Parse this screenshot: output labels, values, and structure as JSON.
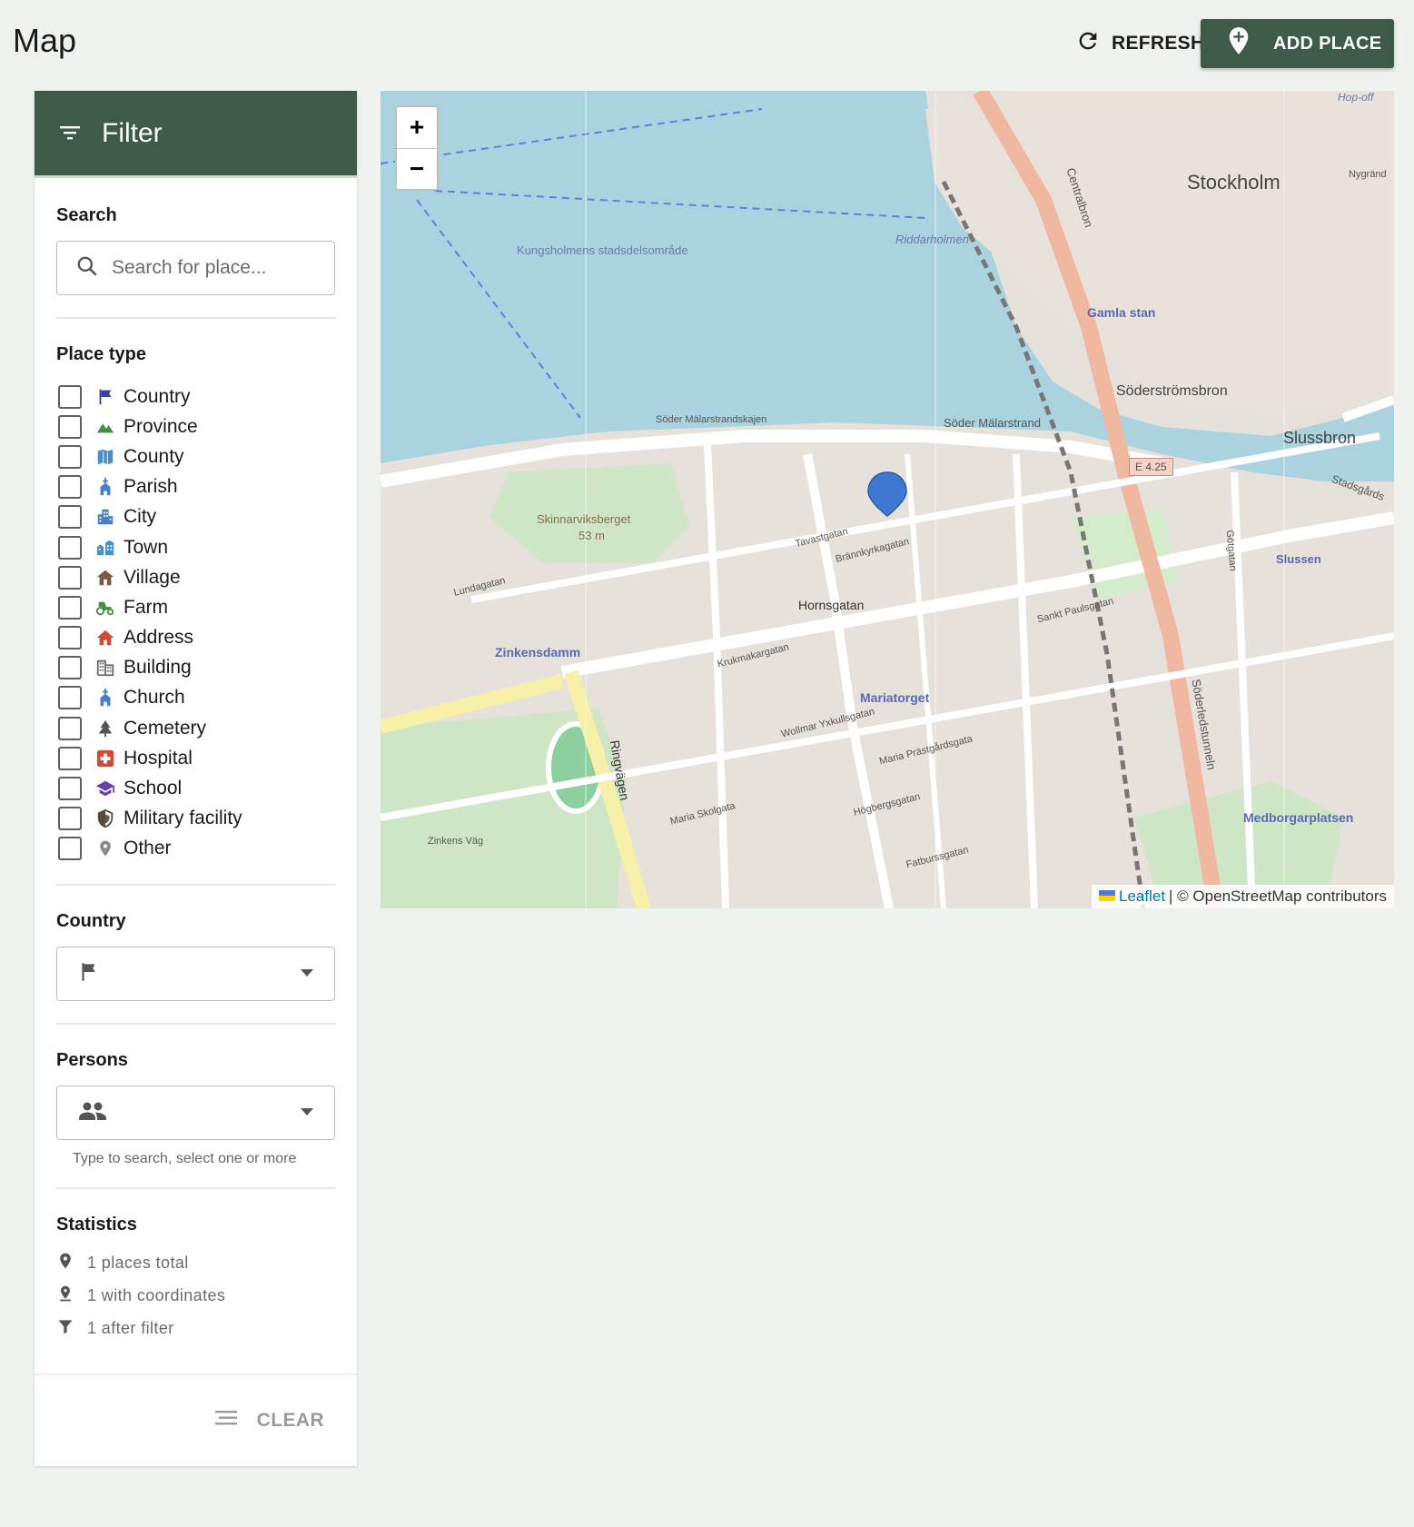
{
  "header": {
    "title": "Map",
    "refresh_label": "REFRESH",
    "add_place_label": "ADD PLACE"
  },
  "filter": {
    "title": "Filter",
    "search": {
      "label": "Search",
      "placeholder": "Search for place..."
    },
    "place_type": {
      "label": "Place type",
      "items": [
        {
          "label": "Country",
          "icon": "flag-icon",
          "color": "#3b3fa0"
        },
        {
          "label": "Province",
          "icon": "mountain-icon",
          "color": "#3f8f3f"
        },
        {
          "label": "County",
          "icon": "map-icon",
          "color": "#4a90c8"
        },
        {
          "label": "Parish",
          "icon": "church-icon",
          "color": "#4a7fc8"
        },
        {
          "label": "City",
          "icon": "city-icon",
          "color": "#4a7fc8"
        },
        {
          "label": "Town",
          "icon": "town-icon",
          "color": "#4a90c8"
        },
        {
          "label": "Village",
          "icon": "house-icon",
          "color": "#7a5a40"
        },
        {
          "label": "Farm",
          "icon": "tractor-icon",
          "color": "#3f8f3f"
        },
        {
          "label": "Address",
          "icon": "home-icon",
          "color": "#d04a3a"
        },
        {
          "label": "Building",
          "icon": "building-icon",
          "color": "#6b6b6b"
        },
        {
          "label": "Church",
          "icon": "church-icon",
          "color": "#4a7fc8"
        },
        {
          "label": "Cemetery",
          "icon": "tree-icon",
          "color": "#555555"
        },
        {
          "label": "Hospital",
          "icon": "hospital-icon",
          "color": "#d04a3a"
        },
        {
          "label": "School",
          "icon": "school-icon",
          "color": "#6a3fa8"
        },
        {
          "label": "Military facility",
          "icon": "shield-icon",
          "color": "#5a4a3a"
        },
        {
          "label": "Other",
          "icon": "pin-icon",
          "color": "#8a8a8a"
        }
      ]
    },
    "country": {
      "label": "Country",
      "value": ""
    },
    "persons": {
      "label": "Persons",
      "value": "",
      "helper": "Type to search, select one or more"
    },
    "statistics": {
      "label": "Statistics",
      "places_total": "1 places total",
      "with_coordinates": "1 with coordinates",
      "after_filter": "1 after filter"
    },
    "clear_label": "CLEAR"
  },
  "map": {
    "zoom_in": "+",
    "zoom_out": "−",
    "attribution_leaflet": "Leaflet",
    "attribution_rest": "| © OpenStreetMap contributors",
    "labels": [
      "Stockholm",
      "Kungsholmens stadsdelsområde",
      "Riddarholmen",
      "Gamla stan",
      "Söderströmsbron",
      "Slussbron",
      "Slussen",
      "Söder Mälarstrand",
      "Söder Mälarstrandskajen",
      "Skinnarviksberget",
      "53 m",
      "Zinkensdamm",
      "Hornsgatan",
      "Mariatorget",
      "Medborgarplatsen",
      "Ringvägen",
      "Brännkyrkagatan",
      "Tavastgatan",
      "Wollmar Yxkullsgatan",
      "Högbergsgatan",
      "Fatburssgatan",
      "Götgatan",
      "Söderledstunneln",
      "Centralbron",
      "E 4.25",
      "Sankt Paulsgatan",
      "Krukmakargatan",
      "Lundagatan",
      "Maria Prästgårdsgata",
      "Zinkens Väg",
      "Maria Skolgata",
      "Hop-off",
      "Nygränd",
      "Stadsgårds"
    ],
    "colors": {
      "water": "#aad3df",
      "land": "#f2efe9",
      "urban": "#e0dcd6",
      "road": "#ffffff",
      "major_road": "#f0c3a8",
      "park": "#c8e8c0",
      "marker": "#3f78d0"
    }
  }
}
